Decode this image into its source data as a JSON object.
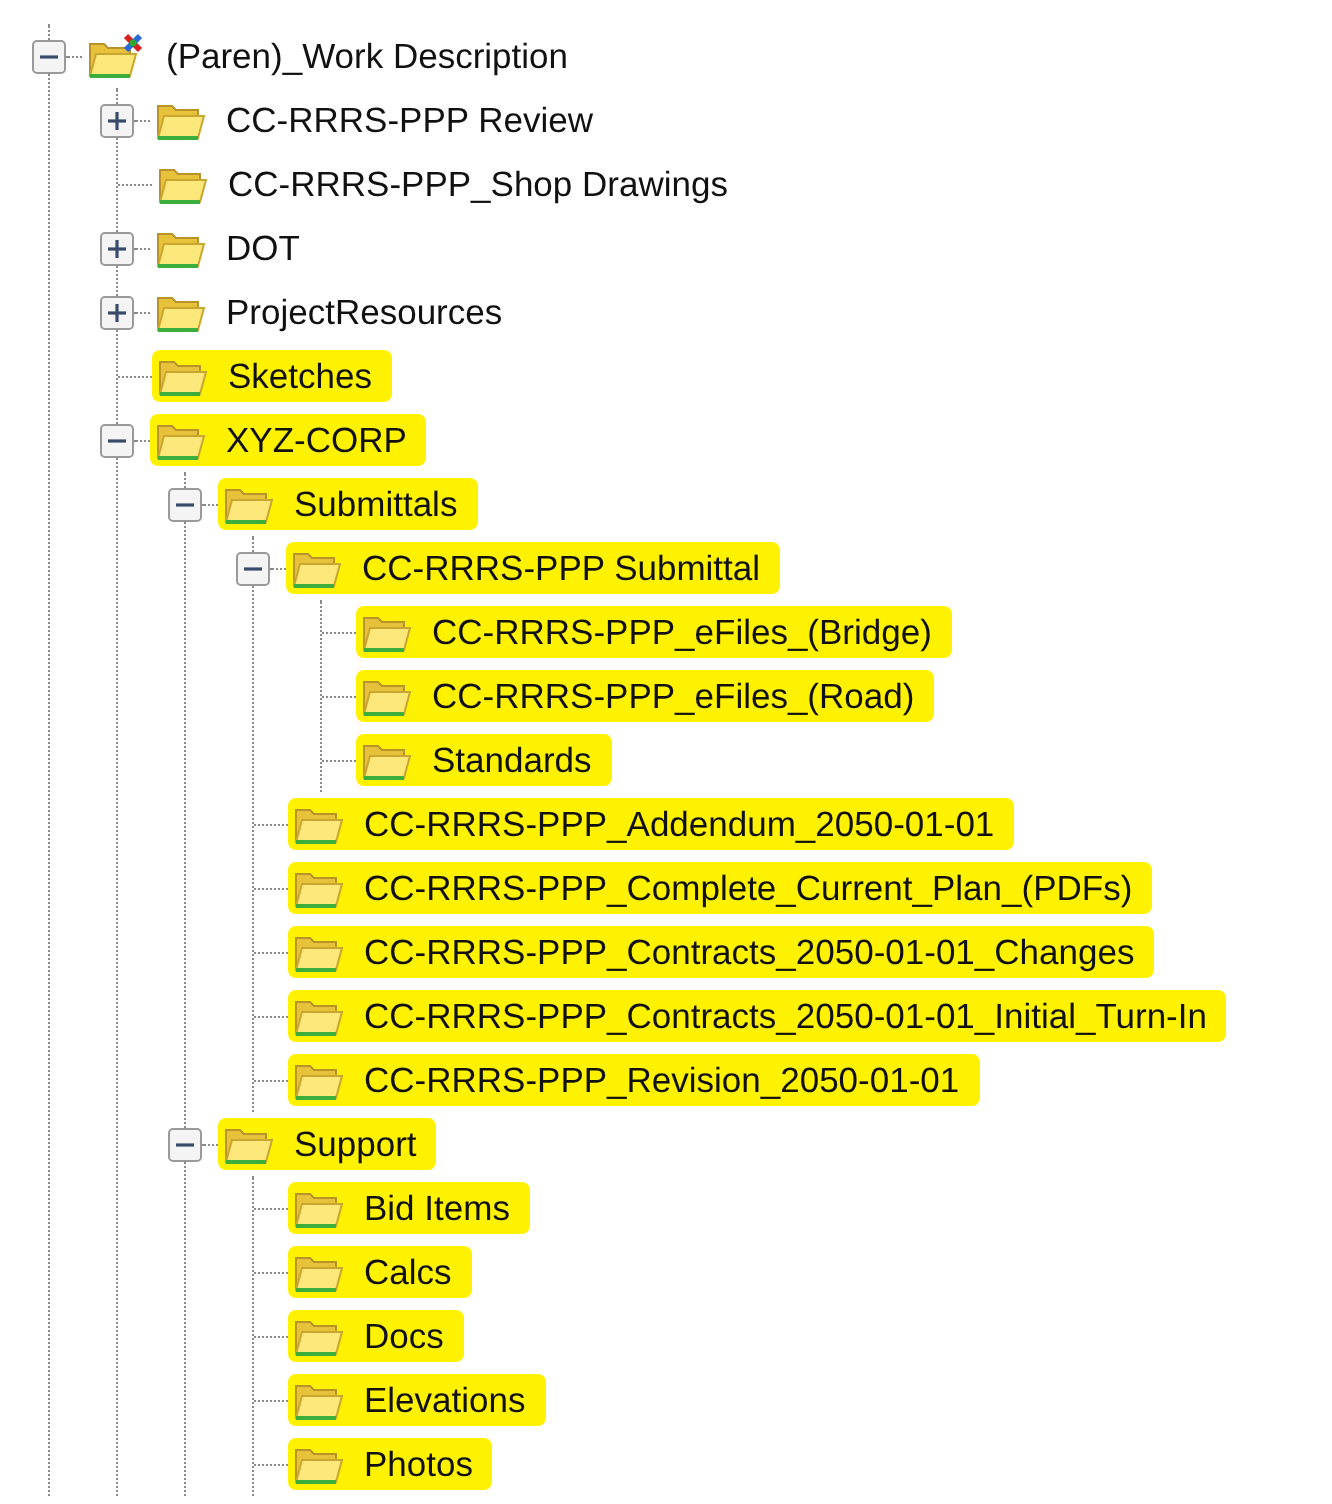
{
  "tree": [
    {
      "label": "(Paren)_Work Description",
      "kind": "project",
      "expanded": true,
      "highlighted": false,
      "children": [
        {
          "label": "CC-RRRS-PPP Review",
          "kind": "folder",
          "expanded": false,
          "highlighted": false
        },
        {
          "label": "CC-RRRS-PPP_Shop Drawings",
          "kind": "folder",
          "highlighted": false
        },
        {
          "label": "DOT",
          "kind": "folder",
          "expanded": false,
          "highlighted": false
        },
        {
          "label": "ProjectResources",
          "kind": "folder",
          "expanded": false,
          "highlighted": false
        },
        {
          "label": "Sketches",
          "kind": "folder",
          "highlighted": true
        },
        {
          "label": "XYZ-CORP",
          "kind": "folder",
          "expanded": true,
          "highlighted": true,
          "children": [
            {
              "label": "Submittals",
              "kind": "folder",
              "expanded": true,
              "highlighted": true,
              "children": [
                {
                  "label": "CC-RRRS-PPP Submittal",
                  "kind": "folder",
                  "expanded": true,
                  "highlighted": true,
                  "children": [
                    {
                      "label": "CC-RRRS-PPP_eFiles_(Bridge)",
                      "kind": "folder",
                      "highlighted": true
                    },
                    {
                      "label": "CC-RRRS-PPP_eFiles_(Road)",
                      "kind": "folder",
                      "highlighted": true
                    },
                    {
                      "label": "Standards",
                      "kind": "folder",
                      "highlighted": true
                    }
                  ]
                },
                {
                  "label": "CC-RRRS-PPP_Addendum_2050-01-01",
                  "kind": "folder",
                  "highlighted": true
                },
                {
                  "label": "CC-RRRS-PPP_Complete_Current_Plan_(PDFs)",
                  "kind": "folder",
                  "highlighted": true
                },
                {
                  "label": "CC-RRRS-PPP_Contracts_2050-01-01_Changes",
                  "kind": "folder",
                  "highlighted": true
                },
                {
                  "label": "CC-RRRS-PPP_Contracts_2050-01-01_Initial_Turn-In",
                  "kind": "folder",
                  "highlighted": true
                },
                {
                  "label": "CC-RRRS-PPP_Revision_2050-01-01",
                  "kind": "folder",
                  "highlighted": true
                }
              ]
            },
            {
              "label": "Support",
              "kind": "folder",
              "expanded": true,
              "highlighted": true,
              "children": [
                {
                  "label": "Bid Items",
                  "kind": "folder",
                  "highlighted": true
                },
                {
                  "label": "Calcs",
                  "kind": "folder",
                  "highlighted": true
                },
                {
                  "label": "Docs",
                  "kind": "folder",
                  "highlighted": true
                },
                {
                  "label": "Elevations",
                  "kind": "folder",
                  "highlighted": true
                },
                {
                  "label": "Photos",
                  "kind": "folder",
                  "highlighted": true
                }
              ]
            }
          ]
        }
      ]
    }
  ]
}
